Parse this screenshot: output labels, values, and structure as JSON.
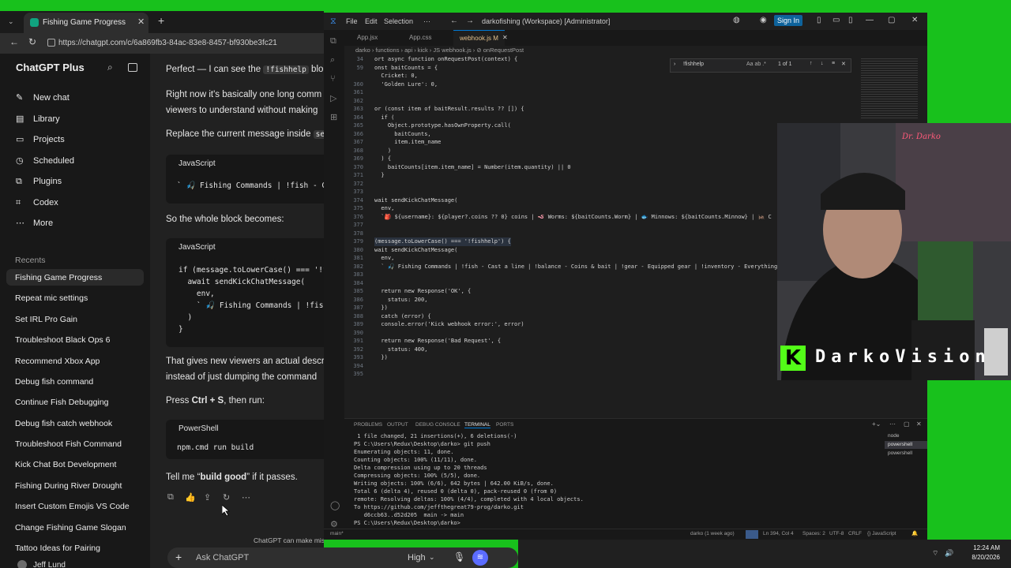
{
  "browser": {
    "tab_title": "Fishing Game Progress",
    "url": "https://chatgpt.com/c/6a869fb3-84ac-83e8-8457-bf930be3fc21"
  },
  "sidebar": {
    "brand": "ChatGPT Plus",
    "nav": [
      {
        "icon": "new-chat-icon",
        "label": "New chat"
      },
      {
        "icon": "library-icon",
        "label": "Library"
      },
      {
        "icon": "projects-icon",
        "label": "Projects"
      },
      {
        "icon": "scheduled-icon",
        "label": "Scheduled"
      },
      {
        "icon": "plugins-icon",
        "label": "Plugins"
      },
      {
        "icon": "codex-icon",
        "label": "Codex"
      },
      {
        "icon": "more-icon",
        "label": "More"
      }
    ],
    "recents_label": "Recents",
    "recents": [
      "Fishing Game Progress",
      "Repeat mic settings",
      "Set IRL Pro Gain",
      "Troubleshoot Black Ops 6",
      "Recommend Xbox App",
      "Debug fish command",
      "Continue Fish Debugging",
      "Debug fish catch webhook",
      "Troubleshoot Fish Command",
      "Kick Chat Bot Development",
      "Fishing During River Drought",
      "Insert Custom Emojis VS Code",
      "Change Fishing Game Slogan",
      "Tattoo Ideas for Pairing"
    ],
    "user": "Jeff Lund"
  },
  "chat": {
    "p1a": "Perfect — I can see the ",
    "p1b": "!fishhelp",
    "p1c": " blo",
    "p2a": "Right now it's basically one long comm",
    "p2b": "viewers to understand without making",
    "p3a": "Replace the current message inside ",
    "p3b": "se",
    "code1_lang": "JavaScript",
    "code1_line": "` 🎣 Fishing Commands | !fish - C",
    "p4": "So the whole block becomes:",
    "code2_lang": "JavaScript",
    "code2_lines": [
      "if (message.toLowerCase() === '!f",
      "  await sendKickChatMessage(",
      "    env,",
      "    ` 🎣 Fishing Commands | !fish",
      "  )",
      "}"
    ],
    "p5a": "That gives new viewers an actual descr",
    "p5b": "instead of just dumping the command",
    "p6a": "Press ",
    "p6b": "Ctrl + S",
    "p6c": ", then run:",
    "code3_lang": "PowerShell",
    "code3_line": "npm.cmd run build",
    "p7a": "Tell me “",
    "p7b": "build good",
    "p7c": "” if it passes.",
    "disclaimer": "ChatGPT can make mis",
    "composer_placeholder": "Ask ChatGPT",
    "model": "High"
  },
  "vscode": {
    "title": "darkofishing (Workspace) [Administrator]",
    "menu": [
      "File",
      "Edit",
      "Selection",
      "···"
    ],
    "sign_in": "Sign In",
    "tabs": [
      {
        "label": "App.jsx",
        "active": false
      },
      {
        "label": "App.css",
        "active": false
      },
      {
        "label": "webhook.js M",
        "active": true
      }
    ],
    "breadcrumb": "darko › functions › api › kick › JS webhook.js › ⊘ onRequestPost",
    "find_query": "!fishhelp",
    "find_count": "1 of 1",
    "code_lines": [
      {
        "n": "34",
        "t": "ort async function onRequestPost(context) {"
      },
      {
        "n": "59",
        "t": "onst baitCounts = {"
      },
      {
        "n": "",
        "t": "  Cricket: 0,"
      },
      {
        "n": "360",
        "t": "  'Golden Lure': 0,"
      },
      {
        "n": "361",
        "t": ""
      },
      {
        "n": "362",
        "t": ""
      },
      {
        "n": "363",
        "t": "or (const item of baitResult.results ?? []) {"
      },
      {
        "n": "364",
        "t": "  if ("
      },
      {
        "n": "365",
        "t": "    Object.prototype.hasOwnProperty.call("
      },
      {
        "n": "366",
        "t": "      baitCounts,"
      },
      {
        "n": "367",
        "t": "      item.item_name"
      },
      {
        "n": "368",
        "t": "    )"
      },
      {
        "n": "369",
        "t": "  ) {"
      },
      {
        "n": "370",
        "t": "    baitCounts[item.item_name] = Number(item.quantity) || 0"
      },
      {
        "n": "371",
        "t": "  }"
      },
      {
        "n": "372",
        "t": ""
      },
      {
        "n": "373",
        "t": ""
      },
      {
        "n": "374",
        "t": "wait sendKickChatMessage("
      },
      {
        "n": "375",
        "t": "  env,"
      },
      {
        "n": "376",
        "t": "  `🎒 ${username}: ${player?.coins ?? 0} coins | 🪱 Worms: ${baitCounts.Worm} | 🐟 Minnows: ${baitCounts.Minnow} | 🦗 C"
      },
      {
        "n": "377",
        "t": ""
      },
      {
        "n": "378",
        "t": ""
      },
      {
        "n": "379",
        "t": "(message.toLowerCase() === '!fishhelp') {"
      },
      {
        "n": "380",
        "t": "wait sendKickChatMessage("
      },
      {
        "n": "381",
        "t": "  env,"
      },
      {
        "n": "382",
        "t": "  ` 🎣 Fishing Commands | !fish - Cast a line | !balance - Coins & bait | !gear - Equipped gear | !inventory - Everything"
      },
      {
        "n": "383",
        "t": ""
      },
      {
        "n": "384",
        "t": ""
      },
      {
        "n": "385",
        "t": "  return new Response('OK', {"
      },
      {
        "n": "386",
        "t": "    status: 200,"
      },
      {
        "n": "387",
        "t": "  })"
      },
      {
        "n": "388",
        "t": "  catch (error) {"
      },
      {
        "n": "389",
        "t": "  console.error('Kick webhook error:', error)"
      },
      {
        "n": "390",
        "t": ""
      },
      {
        "n": "391",
        "t": "  return new Response('Bad Request', {"
      },
      {
        "n": "392",
        "t": "    status: 400,"
      },
      {
        "n": "393",
        "t": "  })"
      },
      {
        "n": "394",
        "t": ""
      },
      {
        "n": "395",
        "t": ""
      }
    ],
    "panel_tabs": [
      "PROBLEMS",
      "OUTPUT",
      "DEBUG CONSOLE",
      "TERMINAL",
      "PORTS"
    ],
    "terminal_lines": [
      " 1 file changed, 21 insertions(+), 6 deletions(-)",
      "PS C:\\Users\\Redux\\Desktop\\darko> git push",
      "Enumerating objects: 11, done.",
      "Counting objects: 100% (11/11), done.",
      "Delta compression using up to 20 threads",
      "Compressing objects: 100% (5/5), done.",
      "Writing objects: 100% (6/6), 642 bytes | 642.00 KiB/s, done.",
      "Total 6 (delta 4), reused 0 (delta 0), pack-reused 0 (from 0)",
      "remote: Resolving deltas: 100% (4/4), completed with 4 local objects.",
      "To https://github.com/jeffthegreat79-prog/darko.git",
      "   d6ccb63..d52d205  main -> main",
      "PS C:\\Users\\Redux\\Desktop\\darko> "
    ],
    "terminals": [
      "node",
      "powershell",
      "powershell"
    ],
    "status_left": "main*",
    "status_items": [
      "darko (1 week ago)",
      "Ln 394, Col 4",
      "Spaces: 2",
      "UTF-8",
      "CRLF",
      "{} JavaScript"
    ]
  },
  "overlay": {
    "cam_sign": "Dr. Darko",
    "brand": "DarkoVision"
  },
  "taskbar": {
    "time": "12:24 AM",
    "date": "8/20/2026"
  }
}
